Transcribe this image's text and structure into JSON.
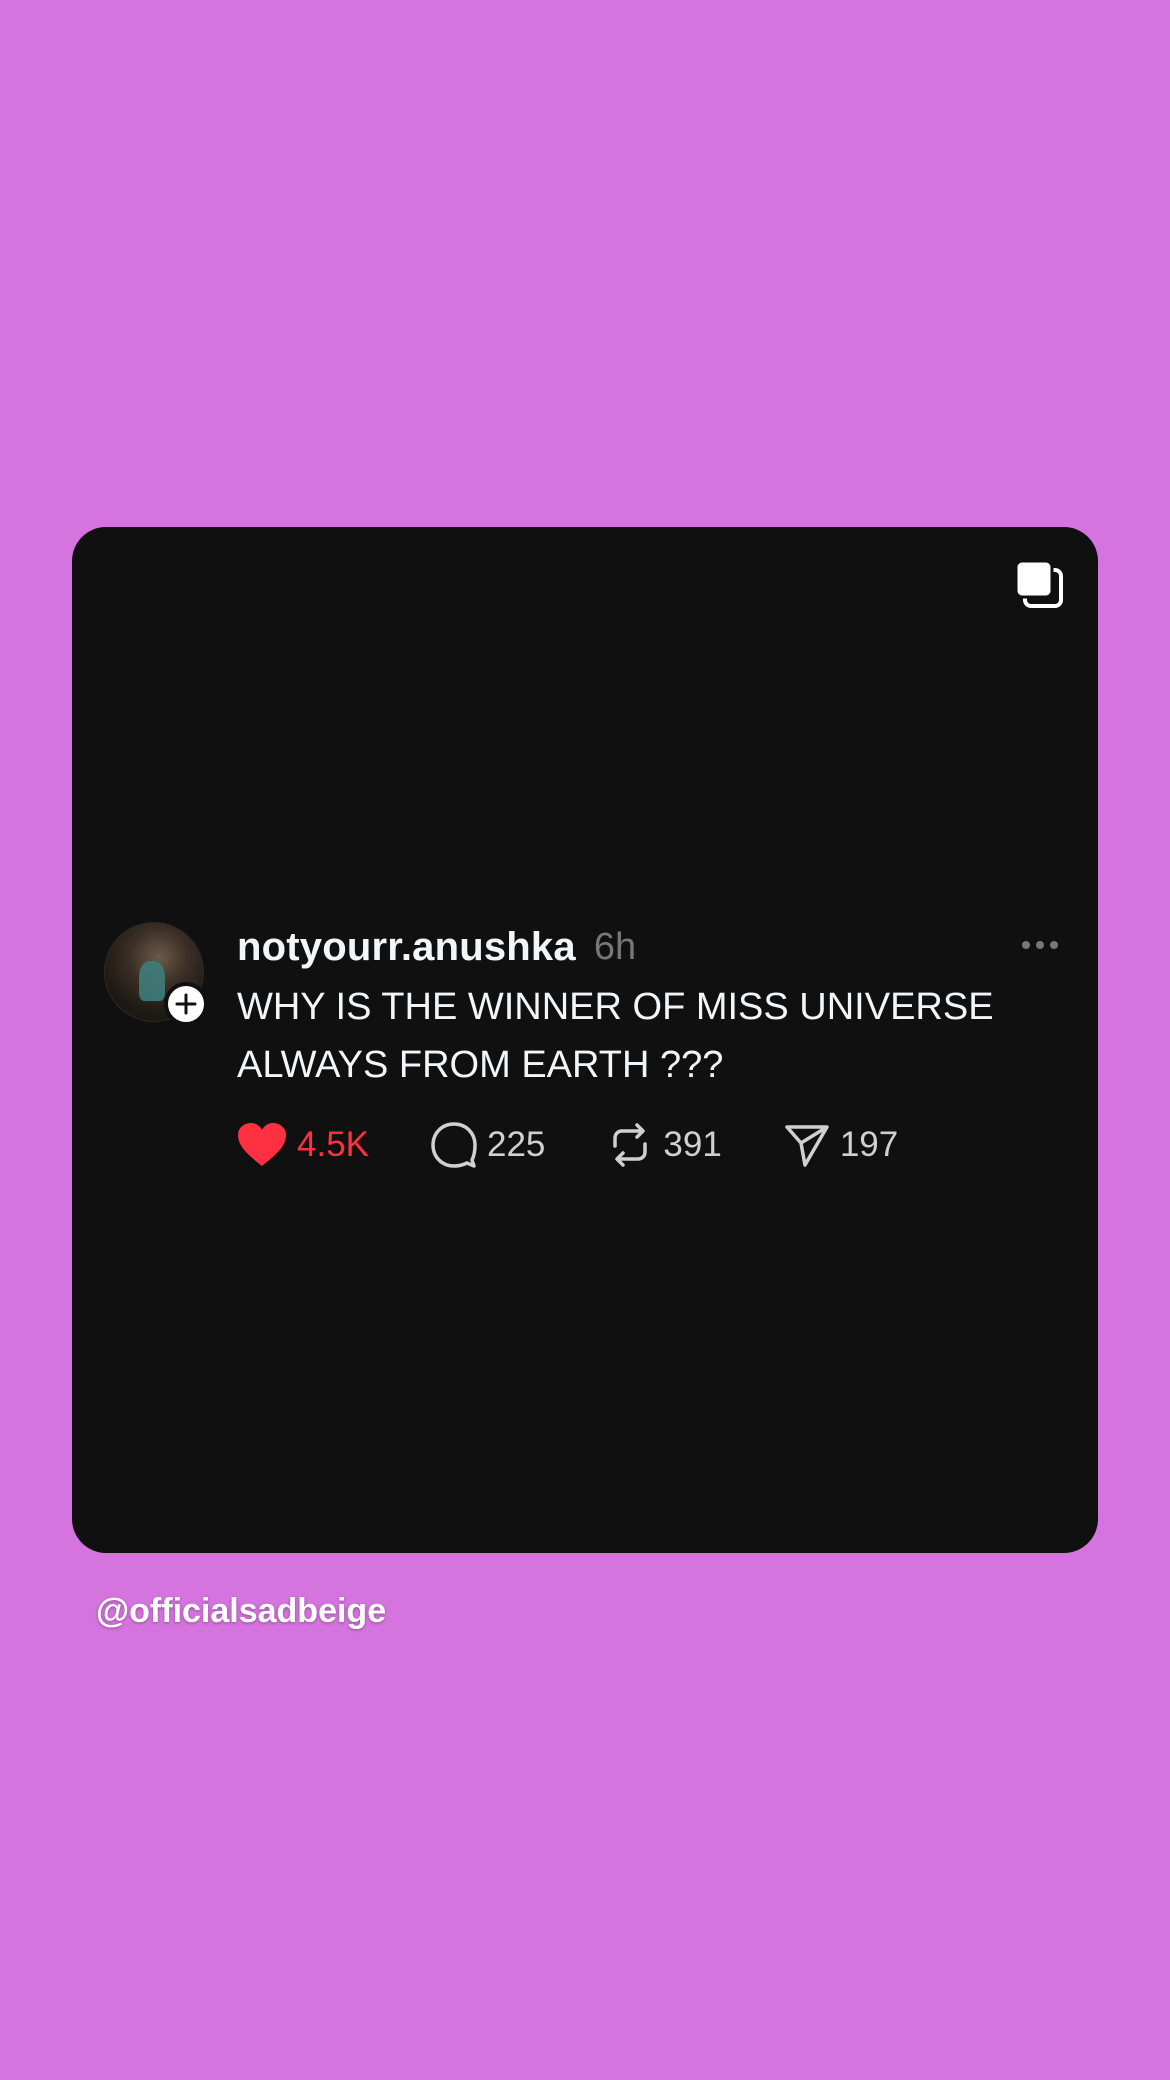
{
  "post": {
    "username": "notyourr.anushka",
    "time": "6h",
    "text": "WHY IS THE WINNER OF MISS UNIVERSE ALWAYS FROM EARTH ???",
    "likes": "4.5K",
    "comments": "225",
    "reposts": "391",
    "shares": "197"
  },
  "credit": "@officialsadbeige",
  "icons": {
    "carousel": "carousel-icon",
    "more": "more-icon",
    "follow": "plus-icon",
    "like": "heart-icon",
    "comment": "comment-icon",
    "repost": "repost-icon",
    "share": "send-icon"
  },
  "colors": {
    "background": "#d674df",
    "card": "#101010",
    "like": "#ff3040",
    "text": "#f3f5f7",
    "muted": "#777777"
  }
}
